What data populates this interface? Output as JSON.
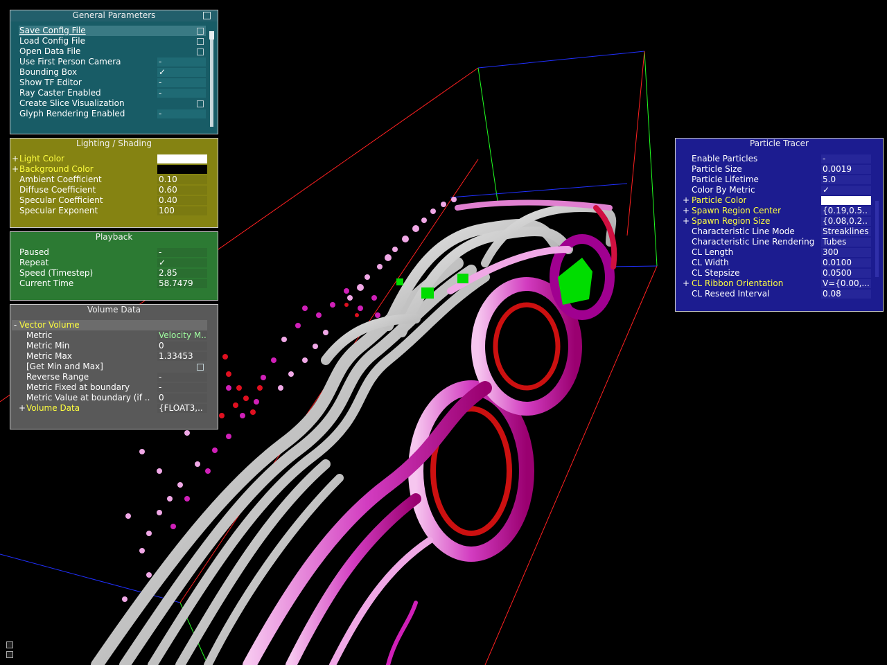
{
  "general": {
    "title": "General Parameters",
    "items": [
      {
        "label": "Save Config File",
        "value": ""
      },
      {
        "label": "Load Config File",
        "value": ""
      },
      {
        "label": "Open Data File",
        "value": ""
      },
      {
        "label": "Use First Person Camera",
        "value": "-"
      },
      {
        "label": "Bounding Box",
        "value": "✓"
      },
      {
        "label": "Show TF Editor",
        "value": "-"
      },
      {
        "label": "Ray Caster Enabled",
        "value": "-"
      },
      {
        "label": "Create Slice Visualization",
        "value": ""
      },
      {
        "label": "Glyph Rendering Enabled",
        "value": "-"
      }
    ]
  },
  "lighting": {
    "title": "Lighting / Shading",
    "items": [
      {
        "expand": "+",
        "label": "Light Color",
        "value": ""
      },
      {
        "expand": "+",
        "label": "Background Color",
        "value": ""
      },
      {
        "expand": "",
        "label": "Ambient Coefficient",
        "value": "0.10"
      },
      {
        "expand": "",
        "label": "Diffuse Coefficient",
        "value": "0.60"
      },
      {
        "expand": "",
        "label": "Specular Coefficient",
        "value": "0.40"
      },
      {
        "expand": "",
        "label": "Specular Exponent",
        "value": "100"
      }
    ],
    "light_color": "#ffffff",
    "background_color": "#000000"
  },
  "playback": {
    "title": "Playback",
    "items": [
      {
        "label": "Paused",
        "value": "-"
      },
      {
        "label": "Repeat",
        "value": "✓"
      },
      {
        "label": "Speed (Timestep)",
        "value": "2.85"
      },
      {
        "label": "Current Time",
        "value": "58.7479"
      }
    ]
  },
  "volume": {
    "title": "Volume Data",
    "section": {
      "expand": "-",
      "label": "Vector Volume"
    },
    "items": [
      {
        "label": "Metric",
        "value": "Velocity M.."
      },
      {
        "label": "Metric Min",
        "value": "0"
      },
      {
        "label": "Metric Max",
        "value": "1.33453"
      },
      {
        "label": "[Get Min and Max]",
        "value": ""
      },
      {
        "label": "Reverse Range",
        "value": "-"
      },
      {
        "label": "Metric Fixed at boundary",
        "value": "-"
      },
      {
        "label": "Metric Value at boundary (if ..",
        "value": "0"
      }
    ],
    "data_row": {
      "expand": "+",
      "label": "Volume Data",
      "value": "{FLOAT3,.."
    }
  },
  "particle": {
    "title": "Particle Tracer",
    "items": [
      {
        "expand": "",
        "label": "Enable Particles",
        "value": "-"
      },
      {
        "expand": "",
        "label": "Particle Size",
        "value": "0.0019"
      },
      {
        "expand": "",
        "label": "Particle Lifetime",
        "value": "5.0"
      },
      {
        "expand": "",
        "label": "Color By Metric",
        "value": "✓"
      },
      {
        "expand": "+",
        "label": "Particle Color",
        "value": ""
      },
      {
        "expand": "+",
        "label": "Spawn Region Center",
        "value": "{0.19,0.5.."
      },
      {
        "expand": "+",
        "label": "Spawn Region Size",
        "value": "{0.08,0.2.."
      },
      {
        "expand": "",
        "label": "Characteristic Line Mode",
        "value": "Streaklines"
      },
      {
        "expand": "",
        "label": "Characteristic Line Rendering",
        "value": "Tubes"
      },
      {
        "expand": "",
        "label": "CL Length",
        "value": "300"
      },
      {
        "expand": "",
        "label": "CL Width",
        "value": "0.0100"
      },
      {
        "expand": "",
        "label": "CL Stepsize",
        "value": "0.0500"
      },
      {
        "expand": "+",
        "label": "CL Ribbon Orientation",
        "value": "V={0.00,..."
      },
      {
        "expand": "",
        "label": "CL Reseed Interval",
        "value": "0.08"
      }
    ]
  },
  "colors": {
    "gray_tubes": "#c8c8c8",
    "magenta": "#d020c0",
    "pink": "#f0a0e0",
    "red": "#e00020",
    "green": "#00dd00",
    "blue_edge": "#2020ff",
    "red_edge": "#ff2020",
    "green_edge": "#20ff20"
  }
}
